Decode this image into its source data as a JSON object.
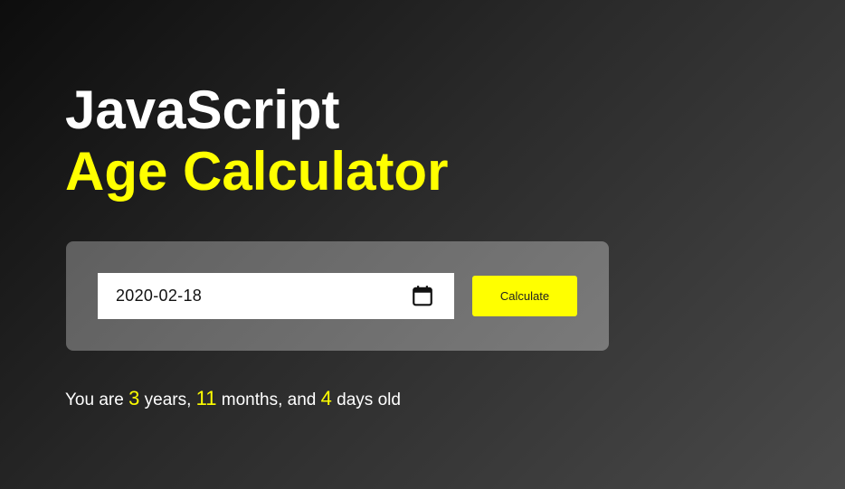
{
  "title": {
    "line1": "JavaScript",
    "line2": "Age Calculator"
  },
  "form": {
    "date_value": "2020-02-18",
    "calendar_icon": "calendar-icon",
    "button_label": "Calculate"
  },
  "result": {
    "prefix": "You are",
    "years": "3",
    "years_label": "years,",
    "months": "11",
    "months_label": "months, and",
    "days": "4",
    "days_label": "days old"
  },
  "colors": {
    "accent": "#ffff00",
    "text": "#ffffff"
  }
}
